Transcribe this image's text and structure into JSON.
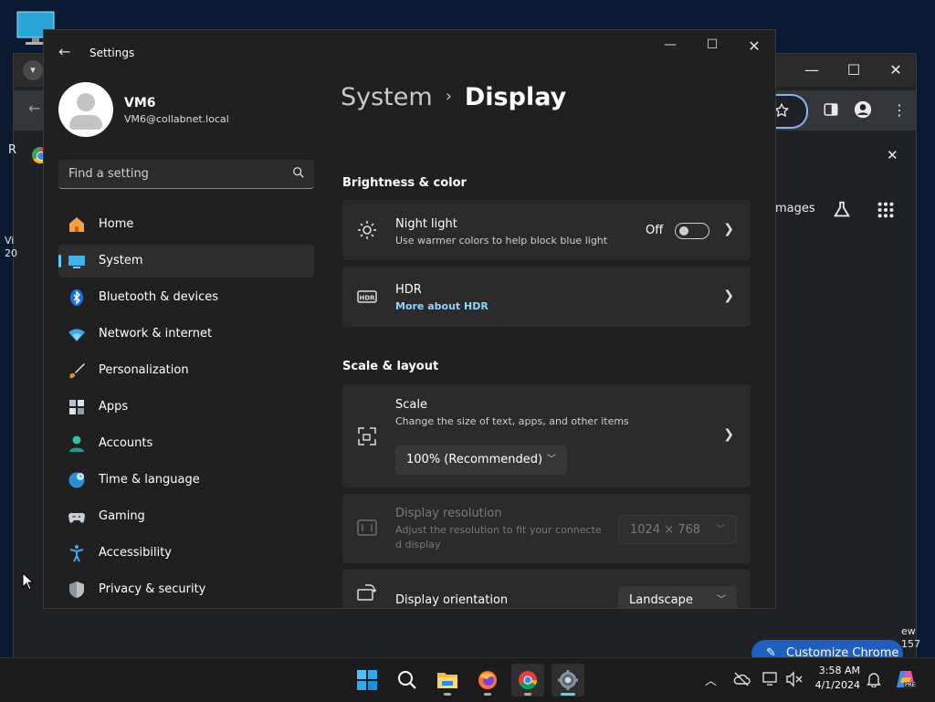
{
  "chrome": {
    "left_fragment_1": "R",
    "left_fragment_2": "Vi",
    "left_fragment_3": "20",
    "images_label": "mages",
    "right_fragment_1": "ew",
    "right_fragment_2": "157",
    "customize_label": "Customize Chrome"
  },
  "settings": {
    "window_title": "Settings",
    "user": {
      "name": "VM6",
      "email": "VM6@collabnet.local"
    },
    "search_placeholder": "Find a setting",
    "nav": [
      {
        "label": "Home",
        "icon": "home-icon"
      },
      {
        "label": "System",
        "icon": "system-icon",
        "active": true
      },
      {
        "label": "Bluetooth & devices",
        "icon": "bluetooth-icon"
      },
      {
        "label": "Network & internet",
        "icon": "wifi-icon"
      },
      {
        "label": "Personalization",
        "icon": "brush-icon"
      },
      {
        "label": "Apps",
        "icon": "apps-icon"
      },
      {
        "label": "Accounts",
        "icon": "accounts-icon"
      },
      {
        "label": "Time & language",
        "icon": "globe-clock-icon"
      },
      {
        "label": "Gaming",
        "icon": "gamepad-icon"
      },
      {
        "label": "Accessibility",
        "icon": "accessibility-icon"
      },
      {
        "label": "Privacy & security",
        "icon": "shield-icon"
      }
    ],
    "breadcrumb": {
      "parent": "System",
      "separator": "›",
      "current": "Display"
    },
    "sections": {
      "brightness": "Brightness & color",
      "scale_layout": "Scale & layout"
    },
    "night_light": {
      "title": "Night light",
      "subtitle": "Use warmer colors to help block blue light",
      "state": "Off"
    },
    "hdr": {
      "title": "HDR",
      "link": "More about HDR"
    },
    "scale": {
      "title": "Scale",
      "subtitle": "Change the size of text, apps, and other items",
      "value": "100% (Recommended)"
    },
    "resolution": {
      "title": "Display resolution",
      "subtitle_1": "Adjust the resolution to fit your connecte",
      "subtitle_2": "d display",
      "value": "1024 × 768"
    },
    "orientation": {
      "title": "Display orientation",
      "value": "Landscape"
    }
  },
  "taskbar": {
    "time": "3:58 AM",
    "date": "4/1/2024",
    "copilot_badge": "PRE"
  },
  "colors": {
    "accent": "#60cdff",
    "link": "#8fd4ff",
    "window_bg": "#202020",
    "card_bg": "#2b2b2b"
  }
}
